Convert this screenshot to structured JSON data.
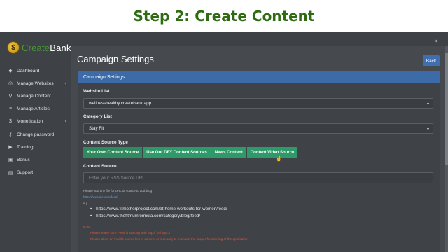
{
  "banner": {
    "title": "Step 2: Create Content"
  },
  "logo": {
    "prefix": "Create",
    "suffix": "Bank"
  },
  "sidebar": {
    "items": [
      {
        "label": "Dashboard",
        "icon": "palette-icon",
        "has_chevron": false
      },
      {
        "label": "Manage Websites",
        "icon": "globe-icon",
        "has_chevron": true
      },
      {
        "label": "Manage Content",
        "icon": "search-icon",
        "has_chevron": false
      },
      {
        "label": "Manage Articles",
        "icon": "list-icon",
        "has_chevron": false
      },
      {
        "label": "Monetization",
        "icon": "dollar-icon",
        "has_chevron": true
      },
      {
        "label": "Change password",
        "icon": "key-icon",
        "has_chevron": false
      },
      {
        "label": "Training",
        "icon": "video-icon",
        "has_chevron": false
      },
      {
        "label": "Bonus",
        "icon": "gift-icon",
        "has_chevron": false
      },
      {
        "label": "Support",
        "icon": "support-icon",
        "has_chevron": false
      }
    ]
  },
  "header": {
    "title": "Campaign Settings",
    "back_label": "Back",
    "logout_icon": "logout-icon"
  },
  "card": {
    "title": "Campaign Settings",
    "website_list_label": "Website List",
    "website_value": "wellnesshealthy.createbank.app",
    "category_list_label": "Category List",
    "category_value": "Stay Fit",
    "source_type_label": "Content Source Type",
    "source_tabs": [
      "Your Own Content Source",
      "Use Our DFY Content Sources",
      "News Content",
      "Content Video Source"
    ],
    "content_source_label": "Content Source",
    "content_source_placeholder": "Enter your RSS Source URL",
    "helper_text": "Please add any file for URL or source to add blog",
    "helper_link": "https://website.com/feed",
    "example_label": "e.g.",
    "feeds": [
      "https://www.fitmotherproject.com/at-home-workouts-for-women/feed/",
      "https://www.thefitmumformula.com/category/blog/feed/"
    ],
    "note_label": "Note:",
    "notes": [
      "Please make sure Feed is starting with http:// or https://",
      "Please allow an invalid source link in content or manually to maintain the proper functioning of the application"
    ]
  },
  "colors": {
    "brand_green": "#2e6b12",
    "sidebar_bg": "#3e4246",
    "card_header": "#3d6ba8",
    "tab_green": "#2e9a6a",
    "note_red": "#e0553a"
  }
}
